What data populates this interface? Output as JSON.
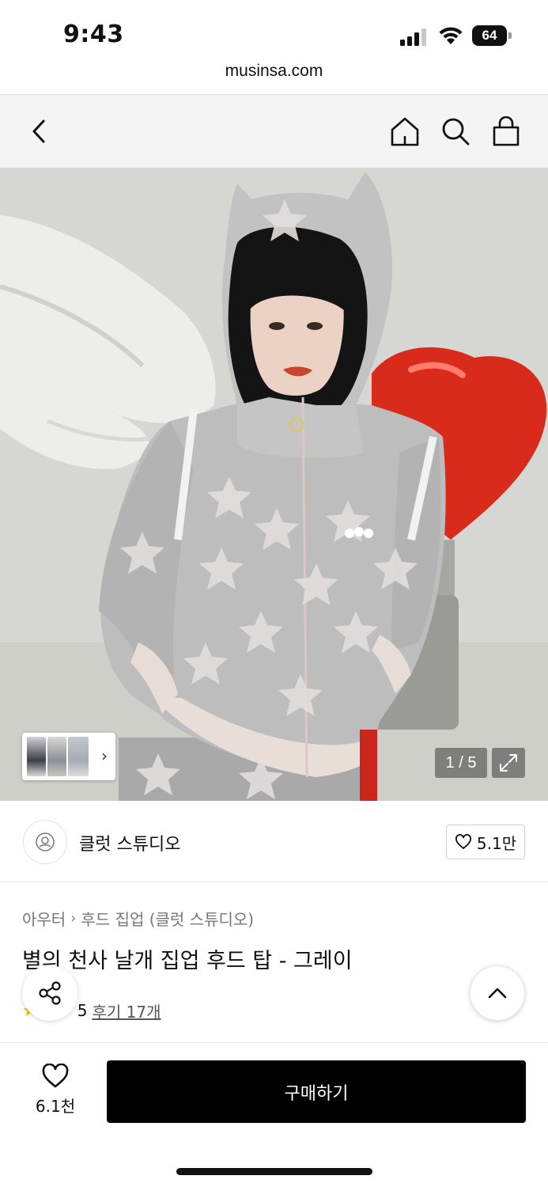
{
  "status_bar": {
    "time": "9:43",
    "battery": "64"
  },
  "browser": {
    "url": "musinsa.com"
  },
  "nav": {
    "back_icon": "chevron-left-icon",
    "home_icon": "home-icon",
    "search_icon": "search-icon",
    "cart_icon": "shopping-bag-icon"
  },
  "gallery": {
    "counter": "1 / 5",
    "current": 1,
    "total": 5,
    "expand_icon": "expand-icon",
    "thumb_arrow": "›"
  },
  "brand": {
    "name": "클럿 스튜디오",
    "like_count": "5.1만"
  },
  "breadcrumb": {
    "category": "아우터",
    "separator": "›",
    "subcategory": "후드 집업 (클럿 스튜디오)"
  },
  "product": {
    "title": "별의 천사 날개 집업 후드 탑 - 그레이",
    "rating_partial": "5",
    "reviews": "후기 17개"
  },
  "bottom_bar": {
    "wish_count": "6.1천",
    "buy_label": "구매하기"
  },
  "colors": {
    "accent": "#000000",
    "star": "#f5b400",
    "nav_bg": "#f4f4f4"
  }
}
